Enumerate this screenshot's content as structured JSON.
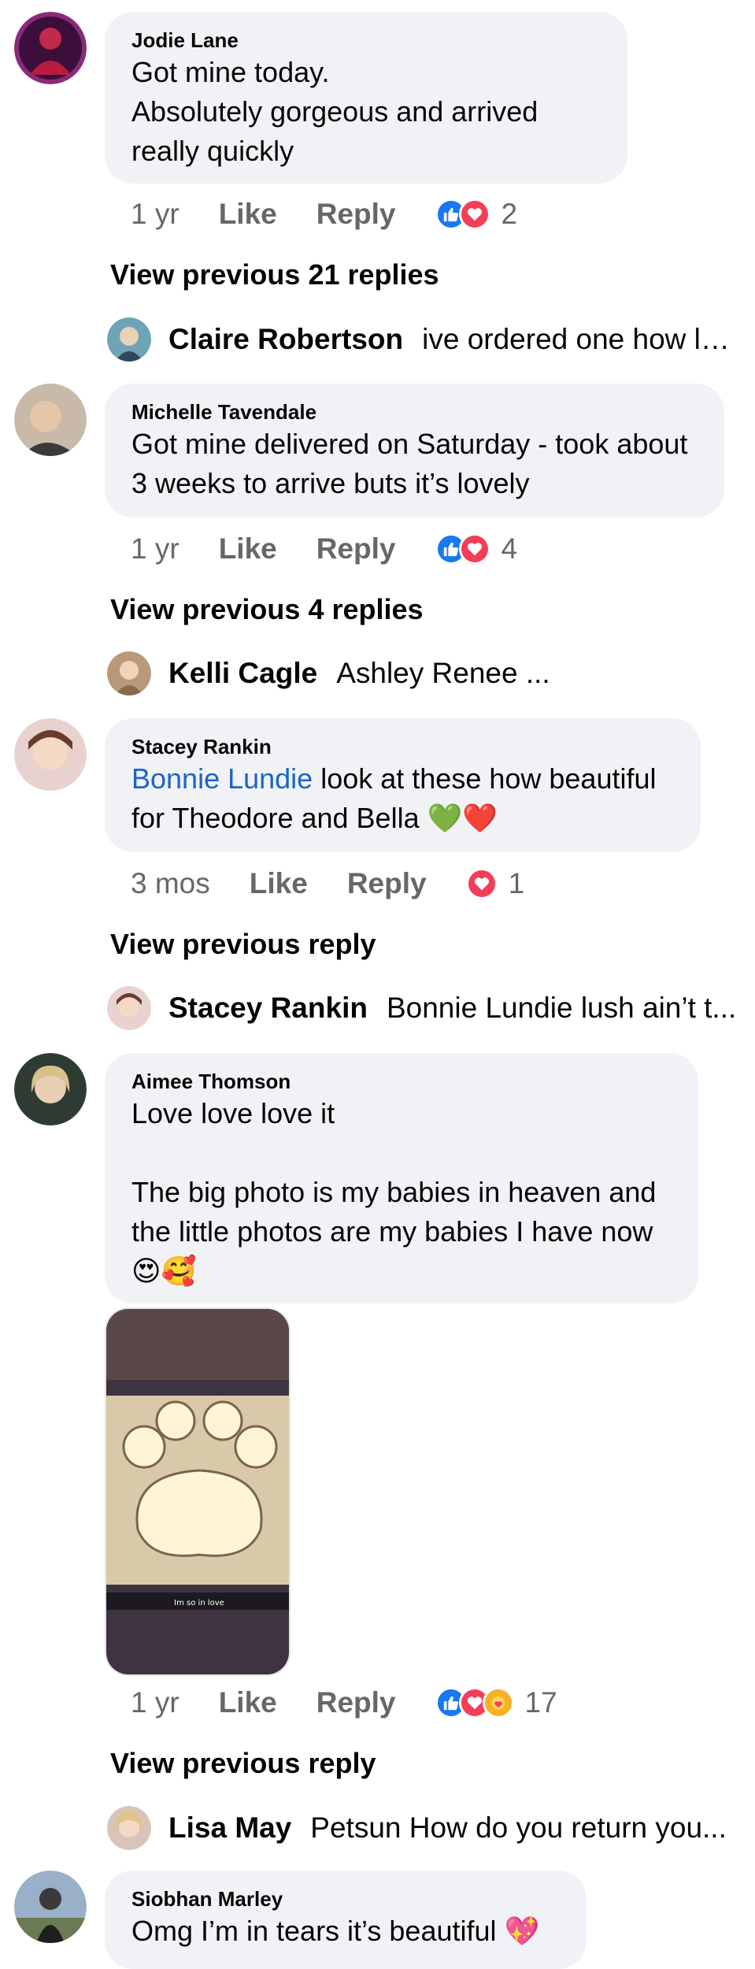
{
  "comments": [
    {
      "author": "Jodie Lane",
      "body": "Got mine today.\nAbsolutely gorgeous and arrived really quickly",
      "time": "1 yr",
      "like": "Like",
      "reply": "Reply",
      "reactions": [
        "like",
        "love"
      ],
      "reaction_count": "2",
      "view_previous": "View previous 21 replies",
      "latest_reply": {
        "author": "Claire Robertson",
        "text": "ive ordered one how lo..."
      }
    },
    {
      "author": "Michelle Tavendale",
      "body": "Got mine delivered on Saturday - took about 3 weeks to arrive buts it’s lovely",
      "time": "1 yr",
      "like": "Like",
      "reply": "Reply",
      "reactions": [
        "like",
        "love"
      ],
      "reaction_count": "4",
      "view_previous": "View previous 4 replies",
      "latest_reply": {
        "author": "Kelli Cagle",
        "text": "Ashley Renee ..."
      }
    },
    {
      "author": "Stacey Rankin",
      "mention": "Bonnie Lundie",
      "body": " look at these how beautiful for Theodore and Bella 💚❤️",
      "time": "3 mos",
      "like": "Like",
      "reply": "Reply",
      "reactions": [
        "love"
      ],
      "reaction_count": "1",
      "view_previous": "View previous reply",
      "latest_reply": {
        "author": "Stacey Rankin",
        "text": "Bonnie Lundie lush ain’t t..."
      }
    },
    {
      "author": "Aimee Thomson",
      "body": "Love love love it\n\nThe big photo is my babies in heaven and the little photos are my babies I have now 😍🥰",
      "photo_caption": "Im so in love",
      "time": "1 yr",
      "like": "Like",
      "reply": "Reply",
      "reactions": [
        "like",
        "love",
        "care"
      ],
      "reaction_count": "17",
      "view_previous": "View previous reply",
      "latest_reply": {
        "author": "Lisa May",
        "text": "Petsun  How do you return you..."
      }
    },
    {
      "author": "Siobhan Marley",
      "body": "Omg I’m in tears it’s beautiful 💖"
    }
  ],
  "colors": {
    "bubble": "#f0f2f5",
    "like_blue": "#1877f2",
    "love_red": "#f33e58",
    "care_yellow": "#f7b125",
    "mention": "#1c64c8",
    "meta_gray": "#65676b"
  }
}
